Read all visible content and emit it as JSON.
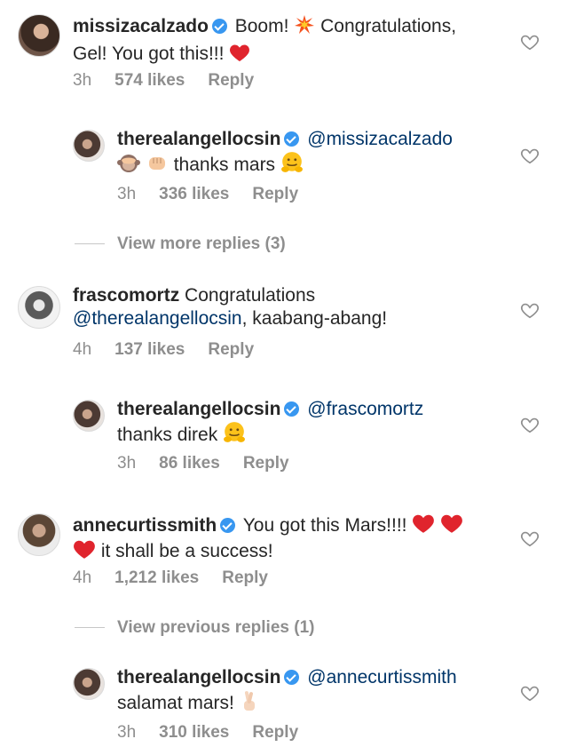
{
  "comments": [
    {
      "username": "missizacalzado",
      "text_1": "Boom!",
      "text_2": "Congratulations,",
      "text_3": "Gel! You got this!!!",
      "time": "3h",
      "likes": "574 likes",
      "reply": "Reply",
      "reply_item": {
        "username": "therealangellocsin",
        "mention": "@missizacalzado",
        "text": "thanks mars",
        "time": "3h",
        "likes": "336 likes",
        "reply": "Reply"
      },
      "view_more": "View more replies (3)"
    },
    {
      "username": "frascomortz",
      "text_1": "Congratulations",
      "mention": "@therealangellocsin",
      "text_2": ", kaabang-abang!",
      "time": "4h",
      "likes": "137 likes",
      "reply": "Reply",
      "reply_item": {
        "username": "therealangellocsin",
        "mention": "@frascomortz",
        "text": "thanks direk",
        "time": "3h",
        "likes": "86 likes",
        "reply": "Reply"
      }
    },
    {
      "username": "annecurtissmith",
      "text_1": "You got this Mars!!!!",
      "text_2": "it shall be a success!",
      "time": "4h",
      "likes": "1,212 likes",
      "reply": "Reply",
      "view_previous": "View previous replies (1)",
      "reply_item": {
        "username": "therealangellocsin",
        "mention": "@annecurtissmith",
        "text": "salamat mars!",
        "time": "3h",
        "likes": "310 likes",
        "reply": "Reply"
      }
    }
  ],
  "colors": {
    "verified": "#3897f0",
    "mention": "#003569",
    "meta": "#8e8e8e",
    "heart": "#e0242d"
  }
}
